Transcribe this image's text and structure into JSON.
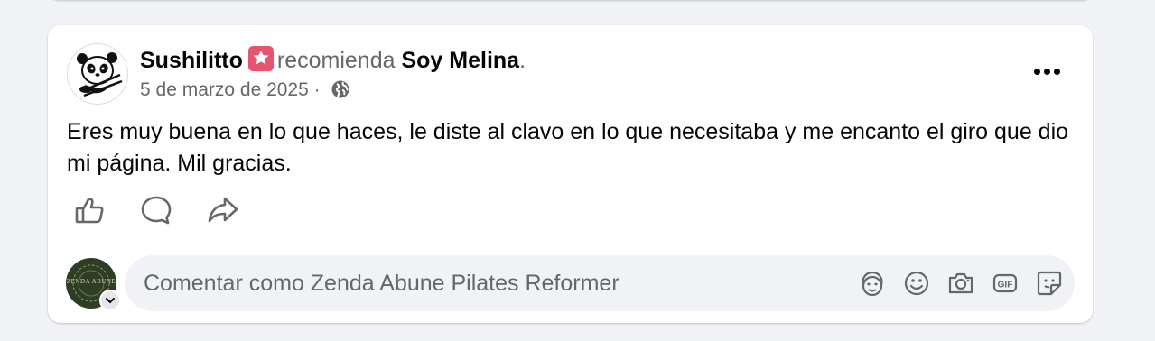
{
  "post": {
    "author": "Sushilitto",
    "verb": "recomienda",
    "page": "Soy Melina",
    "period": ".",
    "date": "5 de marzo de 2025",
    "separator": "·",
    "visibility_icon": "globe-icon",
    "avatar_icon": "panda-icon",
    "badge_icon": "star-badge-icon",
    "body": "Eres muy buena en lo que haces, le diste al clavo en lo que necesitaba y me encanto el giro que dio mi página. Mil gracias."
  },
  "actions": [
    {
      "name": "like",
      "icon": "thumbs-up-icon"
    },
    {
      "name": "comment",
      "icon": "speech-bubble-icon"
    },
    {
      "name": "share",
      "icon": "share-arrow-icon"
    }
  ],
  "composer": {
    "avatar_text": "ZENDA ABUNE",
    "placeholder": "Comentar como Zenda Abune Pilates Reformer",
    "tools": [
      "avatar-sticker-icon",
      "emoji-icon",
      "camera-icon",
      "gif-icon",
      "sticker-icon"
    ],
    "gif_label": "GIF"
  },
  "colors": {
    "background": "#f0f2f5",
    "card": "#ffffff",
    "primary_text": "#050505",
    "secondary_text": "#65676b",
    "badge": "#e8546d"
  }
}
